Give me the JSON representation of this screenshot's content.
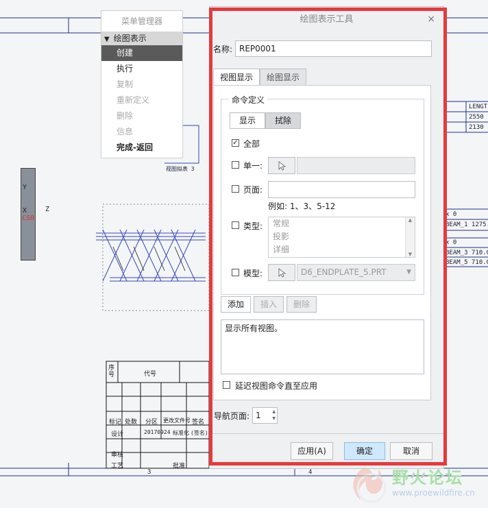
{
  "drawing": {
    "view_label": "视图拟表 3",
    "axis_y": "Y",
    "axis_x": "X",
    "axis_z": "Z",
    "cs_label": "CS0",
    "table_right": [
      {
        "text": "LENGT"
      },
      {
        "text": "2550"
      },
      {
        "text": "2130"
      }
    ],
    "beam_rows": [
      "x 0",
      "BEAM_1 1275.0",
      "x 0",
      "BEAM_3 710.0",
      "BEAM_5 710.0"
    ],
    "title_block": {
      "seq": "序号",
      "code": "代号",
      "row_labels": [
        "标记",
        "处数",
        "分区",
        "更改文件号",
        "签名"
      ],
      "design": "设计",
      "date": "20170924",
      "standard": "标准化",
      "sign": "(签名)",
      "review": "审核",
      "process": "工艺",
      "approve": "批准"
    },
    "zone_numbers": [
      "3",
      "4"
    ]
  },
  "menu_manager": {
    "title": "菜单管理器",
    "section": "绘图表示",
    "items": [
      {
        "label": "创建",
        "state": "active"
      },
      {
        "label": "执行",
        "state": "normal"
      },
      {
        "label": "复制",
        "state": "disabled"
      },
      {
        "label": "重新定义",
        "state": "disabled"
      },
      {
        "label": "删除",
        "state": "disabled"
      },
      {
        "label": "信息",
        "state": "disabled"
      },
      {
        "label": "完成-返回",
        "state": "bold"
      }
    ]
  },
  "dialog": {
    "title": "绘图表示工具",
    "close": "×",
    "name_label": "名称:",
    "name_value": "REP0001",
    "tabs": [
      {
        "label": "视图显示",
        "active": true
      },
      {
        "label": "绘图显示",
        "active": false
      }
    ],
    "group_title": "命令定义",
    "mode_buttons": [
      {
        "label": "显示",
        "pressed": false
      },
      {
        "label": "拭除",
        "pressed": true
      }
    ],
    "all_label": "全部",
    "all_checked": true,
    "single_label": "单一:",
    "page_label": "页面:",
    "page_example": "例如: 1、3、5-12",
    "type_label": "类型:",
    "type_options": [
      "常规",
      "投影",
      "详细"
    ],
    "model_label": "模型:",
    "model_value": "D6_ENDPLATE_5.PRT",
    "add_button": "添加",
    "insert_button": "插入",
    "delete_button": "删除",
    "command_text": "显示所有视图。",
    "defer_label": "延迟视图命令直至应用",
    "nav_label": "导航页面:",
    "nav_value": "1",
    "apply_button": "应用(A)",
    "ok_button": "确定",
    "cancel_button": "取消"
  },
  "watermark": {
    "text": "野火论坛",
    "url": "www.proewildfire.cn"
  },
  "colors": {
    "highlight_border": "#e53a3a",
    "primary_button": "#cfe8fb",
    "menu_active": "#5a5a5a"
  }
}
